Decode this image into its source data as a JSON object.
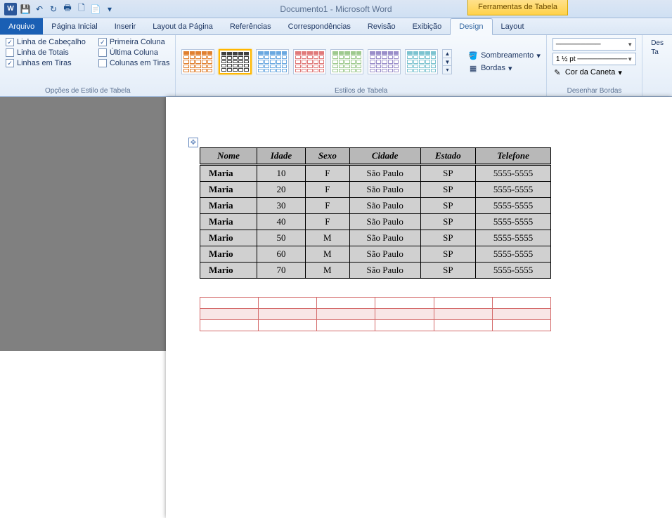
{
  "title": "Documento1 - Microsoft Word",
  "context_tab": "Ferramentas de Tabela",
  "tabs": {
    "file": "Arquivo",
    "home": "Página Inicial",
    "insert": "Inserir",
    "page_layout": "Layout da Página",
    "references": "Referências",
    "mailings": "Correspondências",
    "review": "Revisão",
    "view": "Exibição",
    "design": "Design",
    "layout": "Layout"
  },
  "style_options": {
    "header_row": "Linha de Cabeçalho",
    "total_row": "Linha de Totais",
    "banded_rows": "Linhas em Tiras",
    "first_col": "Primeira Coluna",
    "last_col": "Última Coluna",
    "banded_cols": "Colunas em Tiras",
    "group_label": "Opções de Estilo de Tabela"
  },
  "style_gallery_label": "Estilos de Tabela",
  "shading": {
    "shading_label": "Sombreamento",
    "borders_label": "Bordas"
  },
  "draw_borders": {
    "line_style": "─────────",
    "line_weight": "1 ½ pt ──────────",
    "pen_color": "Cor da Caneta",
    "group_label": "Desenhar Bordas",
    "draw": "Des",
    "table": "Ta"
  },
  "table": {
    "headers": [
      "Nome",
      "Idade",
      "Sexo",
      "Cidade",
      "Estado",
      "Telefone"
    ],
    "rows": [
      [
        "Maria",
        "10",
        "F",
        "São Paulo",
        "SP",
        "5555-5555"
      ],
      [
        "Maria",
        "20",
        "F",
        "São Paulo",
        "SP",
        "5555-5555"
      ],
      [
        "Maria",
        "30",
        "F",
        "São Paulo",
        "SP",
        "5555-5555"
      ],
      [
        "Maria",
        "40",
        "F",
        "São Paulo",
        "SP",
        "5555-5555"
      ],
      [
        "Mario",
        "50",
        "M",
        "São Paulo",
        "SP",
        "5555-5555"
      ],
      [
        "Mario",
        "60",
        "M",
        "São Paulo",
        "SP",
        "5555-5555"
      ],
      [
        "Mario",
        "70",
        "M",
        "São Paulo",
        "SP",
        "5555-5555"
      ]
    ]
  },
  "empty_table": {
    "rows": 3,
    "cols": 6
  }
}
